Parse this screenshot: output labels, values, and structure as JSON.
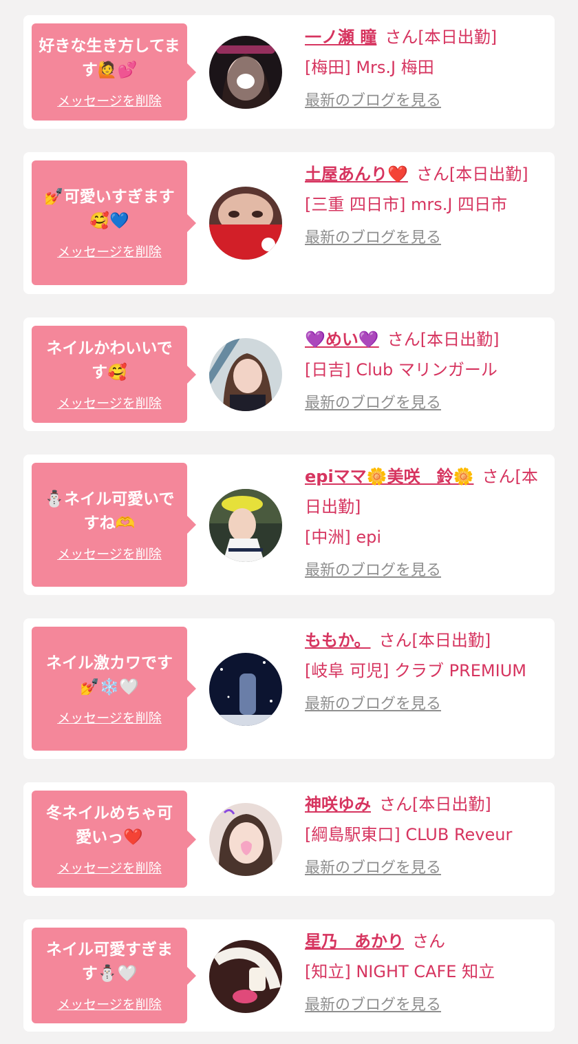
{
  "delete_label": "メッセージを削除",
  "blog_label": "最新のブログを見る",
  "colors": {
    "background": "#f3f2f2",
    "bubble": "#f4879a",
    "accent": "#d6345f",
    "muted": "#8e8e8e"
  },
  "entries": [
    {
      "message": "好きな生き方してます🙋💕",
      "name": "一ノ瀬 瞳",
      "suffix": "さん[本日出勤]",
      "shop": "[梅田] Mrs.J 梅田"
    },
    {
      "message": "💅可愛いすぎます🥰💙",
      "name": "土屋あんり❤️",
      "suffix": "さん[本日出勤]",
      "shop": "[三重 四日市] mrs.J 四日市"
    },
    {
      "message": "ネイルかわいいです🥰",
      "name": "💜めい💜",
      "suffix": "さん[本日出勤]",
      "shop": "[日吉] Club マリンガール"
    },
    {
      "message": "⛄ネイル可愛いですね🫶",
      "name": "epiママ🌼美咲　鈴🌼",
      "suffix": "さん[本日出勤]",
      "shop": "[中洲] epi"
    },
    {
      "message": "ネイル激カワです💅❄️🤍",
      "name": "ももか。",
      "suffix": "さん[本日出勤]",
      "shop": "[岐阜 可児] クラブ PREMIUM"
    },
    {
      "message": "冬ネイルめちゃ可愛いっ❤️",
      "name": "神咲ゆみ",
      "suffix": "さん[本日出勤]",
      "shop": "[綱島駅東口] CLUB Reveur"
    },
    {
      "message": "ネイル可愛すぎます⛄🤍",
      "name": "星乃　あかり",
      "suffix": "さん",
      "shop": "[知立] NIGHT CAFE 知立"
    }
  ]
}
